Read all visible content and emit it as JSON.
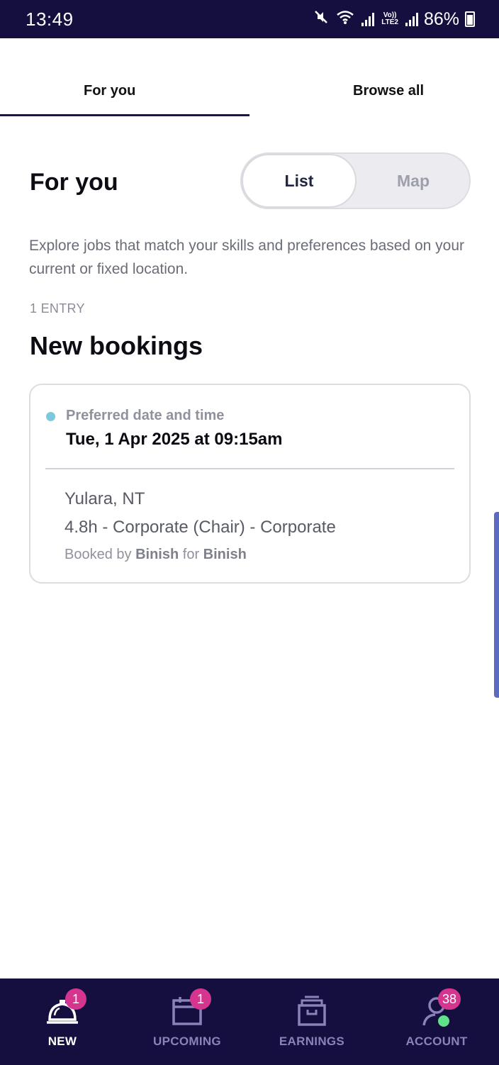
{
  "status_bar": {
    "time": "13:49",
    "volte_top": "Vo))",
    "volte_bottom": "LTE2",
    "battery": "86%"
  },
  "tabs": [
    {
      "label": "For you",
      "active": true
    },
    {
      "label": "Browse all",
      "active": false
    }
  ],
  "header": {
    "title": "For you",
    "view_toggle": {
      "list_label": "List",
      "map_label": "Map",
      "selected": "List"
    }
  },
  "description": "Explore jobs that match your skills and preferences based on your current or fixed location.",
  "entries_label": "1 ENTRY",
  "section_title": "New bookings",
  "booking": {
    "pref_label": "Preferred date and time",
    "date_time": "Tue, 1 Apr 2025 at 09:15am",
    "location": "Yulara, NT",
    "job": "4.8h - Corporate (Chair) - Corporate",
    "booked_prefix": "Booked by",
    "booked_by": "Binish",
    "booked_mid": "for",
    "booked_for": "Binish"
  },
  "bottom_nav": [
    {
      "label": "NEW",
      "icon": "service-bell-icon",
      "badge": "1",
      "active": true
    },
    {
      "label": "UPCOMING",
      "icon": "calendar-icon",
      "badge": "1",
      "active": false
    },
    {
      "label": "EARNINGS",
      "icon": "archive-box-icon",
      "badge": "",
      "active": false
    },
    {
      "label": "ACCOUNT",
      "icon": "user-icon",
      "badge": "38",
      "active": false
    }
  ],
  "colors": {
    "nav_bg": "#150f3f",
    "badge": "#d6358f",
    "online_dot": "#5ee38a",
    "status_dot": "#7cc8dc"
  }
}
